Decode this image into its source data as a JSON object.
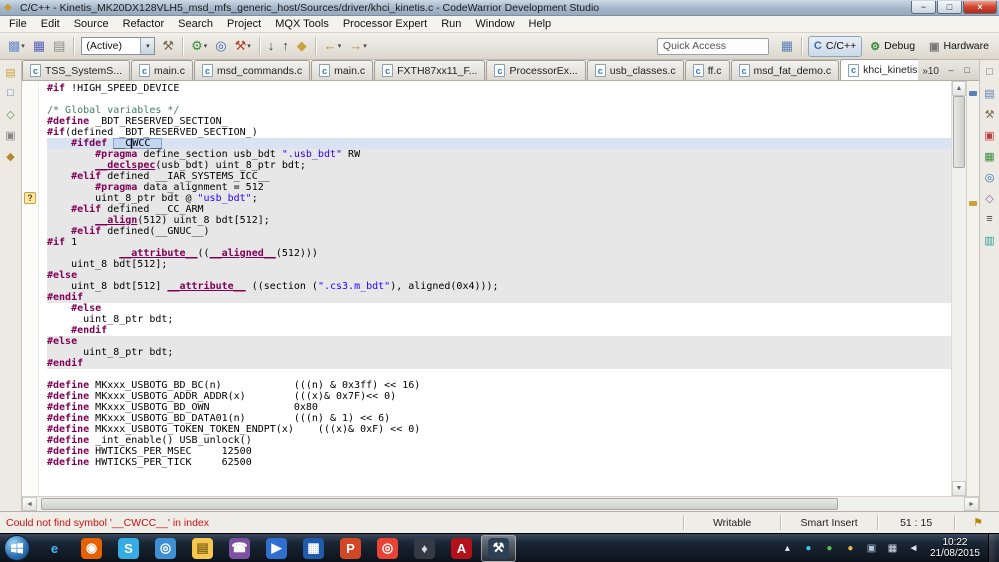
{
  "window": {
    "title": "C/C++ - Kinetis_MK20DX128VLH5_msd_mfs_generic_host/Sources/driver/khci_kinetis.c - CodeWarrior Development Studio",
    "icon_glyph": "◆",
    "controls": {
      "minimize": "−",
      "maximize": "□",
      "close": "×"
    }
  },
  "menubar": {
    "items": [
      "File",
      "Edit",
      "Source",
      "Refactor",
      "Search",
      "Project",
      "MQX Tools",
      "Processor Expert",
      "Run",
      "Window",
      "Help"
    ]
  },
  "toolbar": {
    "dropdown_glyph": "▾",
    "groups": [
      {
        "items": [
          {
            "name": "new-wizard",
            "glyph": "▩",
            "color": "#6a8cc8",
            "dropdown": true
          },
          {
            "name": "save",
            "glyph": "▦",
            "color": "#5565b5"
          },
          {
            "name": "save-all",
            "glyph": "▤",
            "color": "#8a8a8a"
          }
        ]
      },
      {
        "items": [
          {
            "combo": "(Active)"
          },
          {
            "name": "build",
            "glyph": "⚒",
            "color": "#7a6a4a"
          }
        ]
      },
      {
        "items": [
          {
            "name": "debug-configurations",
            "glyph": "⚙",
            "color": "#3a8a3a",
            "dropdown": true
          },
          {
            "name": "search",
            "glyph": "◎",
            "color": "#3a6ab0"
          },
          {
            "name": "external-tools",
            "glyph": "⚒",
            "color": "#b0452a",
            "dropdown": true
          }
        ]
      },
      {
        "items": [
          {
            "name": "next-annotation",
            "glyph": "↓",
            "color": "#444"
          },
          {
            "name": "previous-annotation",
            "glyph": "↑",
            "color": "#444"
          },
          {
            "name": "last-edit-location",
            "glyph": "◆",
            "color": "#c8a23a"
          }
        ]
      },
      {
        "items": [
          {
            "name": "back",
            "glyph": "←",
            "color": "#b8922a",
            "dropdown": true
          },
          {
            "name": "forward",
            "glyph": "→",
            "color": "#b8922a",
            "dropdown": true
          }
        ]
      }
    ],
    "quick_access": {
      "placeholder": "Quick Access"
    },
    "perspectives": {
      "open_icon": "▦",
      "buttons": [
        {
          "label": "C/C++",
          "active": true,
          "glyph": "C",
          "color": "#3a6ab0"
        },
        {
          "label": "Debug",
          "active": false,
          "glyph": "⚙",
          "color": "#3a8a3a"
        },
        {
          "label": "Hardware",
          "active": false,
          "glyph": "▣",
          "color": "#777777"
        }
      ]
    }
  },
  "tabs": {
    "file_icon_glyph": "c",
    "close_glyph": "×",
    "overflow": "»10",
    "minimize_glyph": "–",
    "maximize_glyph": "□",
    "items": [
      {
        "label": "TSS_SystemS...",
        "active": false
      },
      {
        "label": "main.c",
        "active": false
      },
      {
        "label": "msd_commands.c",
        "active": false
      },
      {
        "label": "main.c",
        "active": false
      },
      {
        "label": "FXTH87xx11_F...",
        "active": false
      },
      {
        "label": "ProcessorEx...",
        "active": false
      },
      {
        "label": "usb_classes.c",
        "active": false
      },
      {
        "label": "ff.c",
        "active": false
      },
      {
        "label": "msd_fat_demo.c",
        "active": false
      },
      {
        "label": "khci_kinetis.c",
        "active": true
      }
    ]
  },
  "left_rail": [
    {
      "name": "minimized-project-explorer",
      "glyph": "▤",
      "color": "#c8a23a"
    },
    {
      "name": "minimized-view-2",
      "glyph": "□",
      "color": "#5a7fb5"
    },
    {
      "name": "minimized-view-3",
      "glyph": "◇",
      "color": "#5a9a5a"
    },
    {
      "name": "minimized-view-4",
      "glyph": "▣",
      "color": "#888888"
    },
    {
      "name": "minimized-view-5",
      "glyph": "◆",
      "color": "#b5872a"
    }
  ],
  "right_rail": [
    {
      "name": "restore-panel",
      "glyph": "□",
      "color": "#666666"
    },
    {
      "name": "outline-view",
      "glyph": "▤",
      "color": "#5a7fb5"
    },
    {
      "name": "build-view",
      "glyph": "⚒",
      "color": "#7a6a4a"
    },
    {
      "name": "problems-view",
      "glyph": "▣",
      "color": "#c04040"
    },
    {
      "name": "console-view",
      "glyph": "▦",
      "color": "#3a8a3a"
    },
    {
      "name": "search-view",
      "glyph": "◎",
      "color": "#3a6ab0"
    },
    {
      "name": "call-hierarchy-view",
      "glyph": "◇",
      "color": "#8f5db7"
    },
    {
      "name": "disassembly-view",
      "glyph": "≡",
      "color": "#444444"
    },
    {
      "name": "memory-view",
      "glyph": "▥",
      "color": "#2a9f9f"
    }
  ],
  "editor": {
    "marker": {
      "line": 10,
      "glyph": "?"
    },
    "lines": [
      {
        "segs": [
          [
            "pp",
            "#if"
          ],
          [
            "t",
            " !HIGH_SPEED_DEVICE"
          ]
        ]
      },
      {
        "segs": []
      },
      {
        "segs": [
          [
            "com",
            "/* Global variables */"
          ]
        ]
      },
      {
        "segs": [
          [
            "pp",
            "#define"
          ],
          [
            "t",
            " _BDT_RESERVED_SECTION_"
          ]
        ]
      },
      {
        "segs": [
          [
            "pp",
            "#if"
          ],
          [
            "t",
            "(defined _BDT_RESERVED_SECTION_)"
          ]
        ]
      },
      {
        "bg": "current",
        "segs": [
          [
            "pp",
            "    #ifdef"
          ],
          [
            "t",
            " "
          ],
          [
            "occ",
            "__C"
          ],
          [
            "caret",
            ""
          ],
          [
            "occ",
            "WCC__"
          ]
        ]
      },
      {
        "bg": "inactive",
        "segs": [
          [
            "pp",
            "        #pragma"
          ],
          [
            "t",
            " define_section usb_bdt "
          ],
          [
            "str",
            "\".usb_bdt\""
          ],
          [
            "t",
            " RW"
          ]
        ]
      },
      {
        "bg": "inactive",
        "segs": [
          [
            "t",
            "        "
          ],
          [
            "kwu",
            "__declspec"
          ],
          [
            "t",
            "(usb_bdt) uint_8_ptr bdt;"
          ]
        ]
      },
      {
        "bg": "inactive",
        "segs": [
          [
            "pp",
            "    #elif"
          ],
          [
            "t",
            " defined __IAR_SYSTEMS_ICC__"
          ]
        ]
      },
      {
        "bg": "inactive",
        "segs": [
          [
            "pp",
            "        #pragma"
          ],
          [
            "t",
            " data_alignment = 512"
          ]
        ]
      },
      {
        "bg": "inactive",
        "segs": [
          [
            "t",
            "        uint_8_ptr bdt @ "
          ],
          [
            "str",
            "\"usb_bdt\""
          ],
          [
            "t",
            ";"
          ]
        ]
      },
      {
        "bg": "inactive",
        "segs": [
          [
            "pp",
            "    #elif"
          ],
          [
            "t",
            " defined __CC_ARM"
          ]
        ]
      },
      {
        "bg": "inactive",
        "segs": [
          [
            "t",
            "        "
          ],
          [
            "kwu",
            "__align"
          ],
          [
            "t",
            "(512) uint_8 bdt[512];"
          ]
        ]
      },
      {
        "bg": "inactive",
        "segs": [
          [
            "pp",
            "    #elif"
          ],
          [
            "t",
            " defined(__GNUC__)"
          ]
        ]
      },
      {
        "bg": "inactive",
        "segs": [
          [
            "pp",
            "#if"
          ],
          [
            "t",
            " 1"
          ]
        ]
      },
      {
        "bg": "inactive",
        "segs": [
          [
            "t",
            "            "
          ],
          [
            "kwu",
            "__attribute__"
          ],
          [
            "t",
            "(("
          ],
          [
            "kwu",
            "__aligned__"
          ],
          [
            "t",
            "(512)))"
          ]
        ]
      },
      {
        "bg": "inactive",
        "segs": [
          [
            "t",
            "    uint_8 bdt[512];"
          ]
        ]
      },
      {
        "bg": "inactive",
        "segs": [
          [
            "pp",
            "#else"
          ]
        ]
      },
      {
        "bg": "inactive",
        "segs": [
          [
            "t",
            "    uint_8 bdt[512] "
          ],
          [
            "kwu",
            "__attribute__"
          ],
          [
            "t",
            " ((section ("
          ],
          [
            "str",
            "\".cs3.m_bdt\""
          ],
          [
            "t",
            "), aligned(0x4)));"
          ]
        ]
      },
      {
        "bg": "inactive",
        "segs": [
          [
            "pp",
            "#endif"
          ]
        ]
      },
      {
        "segs": [
          [
            "pp",
            "    #else"
          ]
        ]
      },
      {
        "segs": [
          [
            "t",
            "      uint_8_ptr bdt;"
          ]
        ]
      },
      {
        "segs": [
          [
            "pp",
            "    #endif"
          ]
        ]
      },
      {
        "bg": "inactive",
        "segs": [
          [
            "pp",
            "#else"
          ]
        ]
      },
      {
        "bg": "inactive",
        "segs": [
          [
            "t",
            "      uint_8_ptr bdt;"
          ]
        ]
      },
      {
        "bg": "inactive",
        "segs": [
          [
            "pp",
            "#endif"
          ]
        ]
      },
      {
        "segs": []
      },
      {
        "segs": [
          [
            "pp",
            "#define"
          ],
          [
            "t",
            " MKxxx_USBOTG_BD_BC(n)            (((n) & 0x3ff) << 16)"
          ]
        ]
      },
      {
        "segs": [
          [
            "pp",
            "#define"
          ],
          [
            "t",
            " MKxxx_USBOTG_ADDR_ADDR(x)        (((x)& 0x7F)<< 0)"
          ]
        ]
      },
      {
        "segs": [
          [
            "pp",
            "#define"
          ],
          [
            "t",
            " MKxxx_USBOTG_BD_OWN              0x80"
          ]
        ]
      },
      {
        "segs": [
          [
            "pp",
            "#define"
          ],
          [
            "t",
            " MKxxx_USBOTG_BD_DATA01(n)        (((n) & 1) << 6)"
          ]
        ]
      },
      {
        "segs": [
          [
            "pp",
            "#define"
          ],
          [
            "t",
            " MKxxx_USBOTG_TOKEN_TOKEN_ENDPT(x)    (((x)& 0xF) << 0)"
          ]
        ]
      },
      {
        "segs": [
          [
            "pp",
            "#define"
          ],
          [
            "t",
            " _int_enable() USB_unlock()"
          ]
        ]
      },
      {
        "segs": [
          [
            "pp",
            "#define"
          ],
          [
            "t",
            " HWTICKS_PER_MSEC     12500"
          ]
        ]
      },
      {
        "segs": [
          [
            "pp",
            "#define"
          ],
          [
            "t",
            " HWTICKS_PER_TICK     62500"
          ]
        ]
      }
    ]
  },
  "scrollbars": {
    "up": "▲",
    "down": "▼",
    "left": "◄",
    "right": "►"
  },
  "statusbar": {
    "error": "Could not find symbol '__CWCC__' in index",
    "writable": "Writable",
    "insert_mode": "Smart Insert",
    "position": "51 : 15",
    "icon_glyph": "⚑"
  },
  "taskbar": {
    "apps": [
      {
        "name": "internet-explorer",
        "glyph": "e",
        "fg": "#45b6f2",
        "bg": ""
      },
      {
        "name": "firefox",
        "glyph": "◉",
        "fg": "#ffffff",
        "bg": "#e66000"
      },
      {
        "name": "skype",
        "glyph": "S",
        "fg": "#ffffff",
        "bg": "#35ade3"
      },
      {
        "name": "safari",
        "glyph": "◎",
        "fg": "#ffffff",
        "bg": "#3f8fd4"
      },
      {
        "name": "windows-explorer",
        "glyph": "▤",
        "fg": "#8a6a1a",
        "bg": "#f7c64e"
      },
      {
        "name": "viber",
        "glyph": "☎",
        "fg": "#ffffff",
        "bg": "#7d51a1"
      },
      {
        "name": "media-player",
        "glyph": "▶",
        "fg": "#ffffff",
        "bg": "#2f6fd0"
      },
      {
        "name": "app-blue",
        "glyph": "▦",
        "fg": "#ffffff",
        "bg": "#1f5baa"
      },
      {
        "name": "powerpoint",
        "glyph": "P",
        "fg": "#ffffff",
        "bg": "#d24726"
      },
      {
        "name": "chrome",
        "glyph": "◎",
        "fg": "#ffffff",
        "bg": "#ea4335"
      },
      {
        "name": "app-dark",
        "glyph": "♦",
        "fg": "#cfd8e4",
        "bg": "#333a44"
      },
      {
        "name": "adobe-reader",
        "glyph": "A",
        "fg": "#ffffff",
        "bg": "#b3121a"
      },
      {
        "name": "codewarrior",
        "glyph": "⚒",
        "fg": "#ffffff",
        "bg": "#2b3f55",
        "active": true
      }
    ],
    "tray": [
      {
        "name": "hidden-icons-button",
        "glyph": "▴",
        "color": "#e8eef5"
      },
      {
        "name": "tray-app-icon-1",
        "glyph": "●",
        "color": "#4ac0e8"
      },
      {
        "name": "tray-app-icon-2",
        "glyph": "●",
        "color": "#58c058"
      },
      {
        "name": "tray-app-icon-3",
        "glyph": "●",
        "color": "#e8b84a"
      },
      {
        "name": "tray-app-icon-4",
        "glyph": "▣",
        "color": "#b0c4d8"
      },
      {
        "name": "network-icon",
        "glyph": "▦",
        "color": "#d8e4f0"
      },
      {
        "name": "volume-icon",
        "glyph": "◄",
        "color": "#d8e4f0"
      }
    ],
    "clock": {
      "time": "10:22",
      "date": "21/08/2015"
    }
  }
}
